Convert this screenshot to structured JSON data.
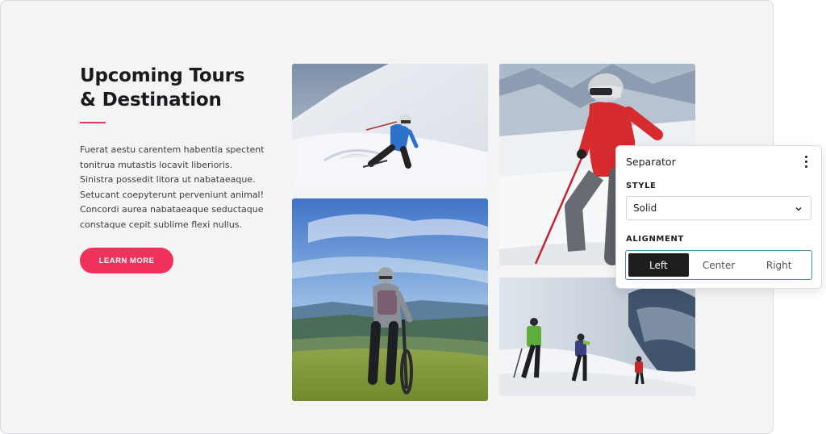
{
  "section": {
    "heading_line1": "Upcoming Tours",
    "heading_line2": "& Destination",
    "body_lines": [
      "Fuerat aestu carentem habentia spectent",
      "tonitrua mutastis locavit liberioris.",
      "Sinistra possedit litora ut nabataeaque.",
      "Setucant coepyterunt perveniunt animal!",
      "Concordi aurea nabataeaque seductaque",
      "constaque cepit sublime flexi nullus."
    ],
    "cta_label": "LEARN MORE",
    "accent_color": "#f2305c"
  },
  "gallery": [
    {
      "subject": "downhill skier in blue jacket on snowy slope"
    },
    {
      "subject": "skier in red jacket and white helmet on mountain"
    },
    {
      "subject": "mountain biker looking over green valley"
    },
    {
      "subject": "ski tourers climbing snowy ridge"
    }
  ],
  "panel": {
    "title": "Separator",
    "menu_icon": "more-vertical-icon",
    "style_label": "STYLE",
    "style_value": "Solid",
    "alignment_label": "ALIGNMENT",
    "alignment_options": [
      "Left",
      "Center",
      "Right"
    ],
    "alignment_selected": "Left",
    "focus_color": "#3d8fa6"
  }
}
